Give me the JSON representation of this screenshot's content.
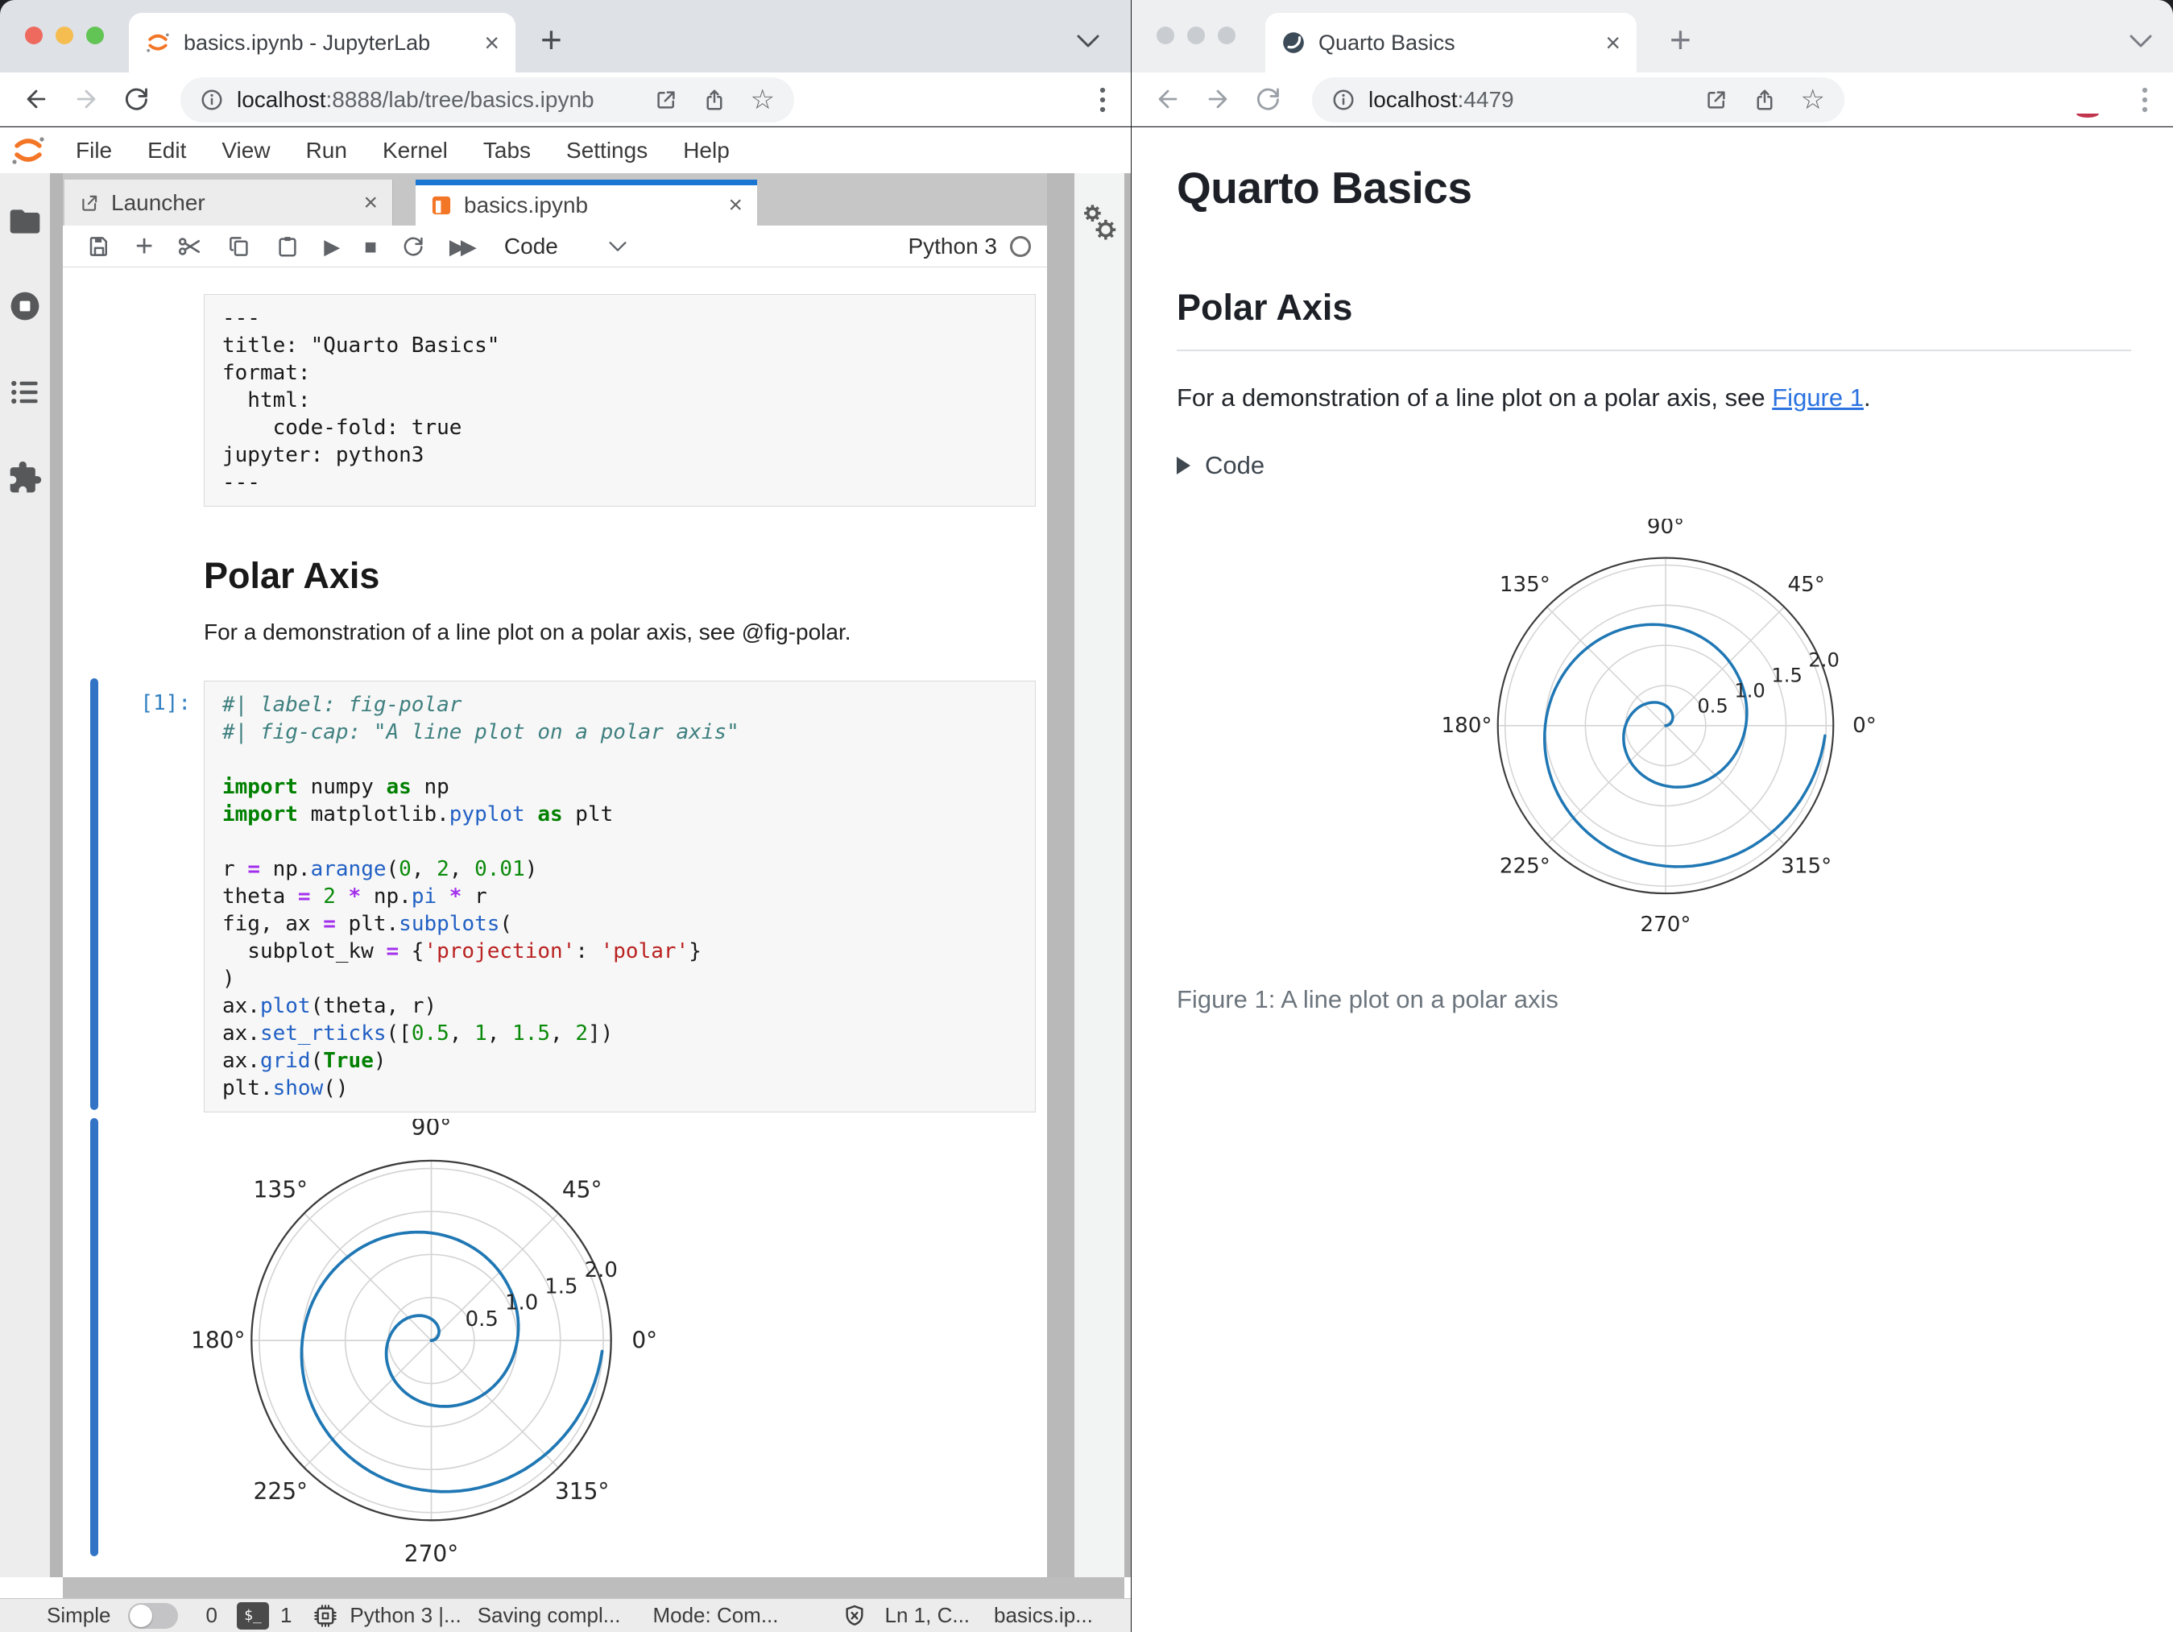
{
  "left_window": {
    "browser": {
      "tab_title": "basics.ipynb - JupyterLab",
      "close_glyph": "×",
      "new_tab_glyph": "+",
      "url_host": "localhost",
      "url_rest": ":8888/lab/tree/basics.ipynb"
    },
    "menu": [
      "File",
      "Edit",
      "View",
      "Run",
      "Kernel",
      "Tabs",
      "Settings",
      "Help"
    ],
    "doc_tabs": {
      "launcher": "Launcher",
      "notebook": "basics.ipynb",
      "close_glyph": "×"
    },
    "toolbar": {
      "plus_glyph": "+",
      "run_glyph": "▶",
      "stop_glyph": "■",
      "ff_glyph": "▶▶",
      "cell_type": "Code",
      "kernel_name": "Python 3"
    },
    "notebook": {
      "yaml_lines": [
        "---",
        "title: \"Quarto Basics\"",
        "format:",
        "  html:",
        "    code-fold: true",
        "jupyter: python3",
        "---"
      ],
      "md_heading": "Polar Axis",
      "md_paragraph": "For a demonstration of a line plot on a polar axis, see @fig-polar.",
      "execution_prompt": "[1]:",
      "code_lines": [
        [
          [
            "c",
            "#| label: fig-polar"
          ]
        ],
        [
          [
            "c",
            "#| fig-cap: \"A line plot on a polar axis\""
          ]
        ],
        [],
        [
          [
            "k",
            "import"
          ],
          [
            "t",
            " numpy "
          ],
          [
            "k",
            "as"
          ],
          [
            "t",
            " np"
          ]
        ],
        [
          [
            "k",
            "import"
          ],
          [
            "t",
            " matplotlib."
          ],
          [
            "p",
            "pyplot"
          ],
          [
            "t",
            " "
          ],
          [
            "k",
            "as"
          ],
          [
            "t",
            " plt"
          ]
        ],
        [],
        [
          [
            "t",
            "r "
          ],
          [
            "o",
            "="
          ],
          [
            "t",
            " np."
          ],
          [
            "p",
            "arange"
          ],
          [
            "t",
            "("
          ],
          [
            "n",
            "0"
          ],
          [
            "t",
            ", "
          ],
          [
            "n",
            "2"
          ],
          [
            "t",
            ", "
          ],
          [
            "n",
            "0.01"
          ],
          [
            "t",
            ")"
          ]
        ],
        [
          [
            "t",
            "theta "
          ],
          [
            "o",
            "="
          ],
          [
            "t",
            " "
          ],
          [
            "n",
            "2"
          ],
          [
            "t",
            " "
          ],
          [
            "o",
            "*"
          ],
          [
            "t",
            " np."
          ],
          [
            "p",
            "pi"
          ],
          [
            "t",
            " "
          ],
          [
            "o",
            "*"
          ],
          [
            "t",
            " r"
          ]
        ],
        [
          [
            "t",
            "fig, ax "
          ],
          [
            "o",
            "="
          ],
          [
            "t",
            " plt."
          ],
          [
            "p",
            "subplots"
          ],
          [
            "t",
            "("
          ]
        ],
        [
          [
            "t",
            "  subplot_kw "
          ],
          [
            "o",
            "="
          ],
          [
            "t",
            " {"
          ],
          [
            "s",
            "'projection'"
          ],
          [
            "t",
            ": "
          ],
          [
            "s",
            "'polar'"
          ],
          [
            "t",
            "}"
          ]
        ],
        [
          [
            "t",
            ")"
          ]
        ],
        [
          [
            "t",
            "ax."
          ],
          [
            "p",
            "plot"
          ],
          [
            "t",
            "(theta, r)"
          ]
        ],
        [
          [
            "t",
            "ax."
          ],
          [
            "p",
            "set_rticks"
          ],
          [
            "t",
            "(["
          ],
          [
            "n",
            "0.5"
          ],
          [
            "t",
            ", "
          ],
          [
            "n",
            "1"
          ],
          [
            "t",
            ", "
          ],
          [
            "n",
            "1.5"
          ],
          [
            "t",
            ", "
          ],
          [
            "n",
            "2"
          ],
          [
            "t",
            "])"
          ]
        ],
        [
          [
            "t",
            "ax."
          ],
          [
            "p",
            "grid"
          ],
          [
            "t",
            "("
          ],
          [
            "k",
            "True"
          ],
          [
            "t",
            ")"
          ]
        ],
        [
          [
            "t",
            "plt."
          ],
          [
            "p",
            "show"
          ],
          [
            "t",
            "()"
          ]
        ]
      ]
    },
    "status_bar": {
      "simple": "Simple",
      "terminals": "0",
      "terminal_glyph": "$_",
      "kernels": "1",
      "kernel": "Python 3 |...",
      "saving": "Saving compl...",
      "mode": "Mode: Com...",
      "cursor": "Ln 1, C...",
      "file": "basics.ip..."
    }
  },
  "right_window": {
    "browser": {
      "tab_title": "Quarto Basics",
      "close_glyph": "×",
      "new_tab_glyph": "+",
      "url_host": "localhost",
      "url_rest": ":4479"
    },
    "page": {
      "title": "Quarto Basics",
      "section": "Polar Axis",
      "para_before": "For a demonstration of a line plot on a polar axis, see ",
      "link": "Figure 1",
      "para_after": ".",
      "code_toggle": "Code",
      "figure_caption": "Figure 1: A line plot on a polar axis"
    }
  },
  "chart_data": {
    "type": "line",
    "projection": "polar",
    "title": "A line plot on a polar axis",
    "series": [
      {
        "name": "spiral",
        "r_start": 0,
        "r_end": 2,
        "r_step": 0.01,
        "theta_formula": "theta = 2*pi*r"
      }
    ],
    "theta_ticks_deg": [
      0,
      45,
      90,
      135,
      180,
      225,
      270,
      315
    ],
    "theta_tick_labels": [
      "0°",
      "45°",
      "90°",
      "135°",
      "180°",
      "225°",
      "270°",
      "315°"
    ],
    "r_ticks": [
      0.5,
      1,
      1.5,
      2
    ],
    "r_tick_labels": [
      "0.5",
      "1.0",
      "1.5",
      "2.0"
    ],
    "r_axis_max": 2.09,
    "r_label_angle_deg": 22.5,
    "grid": true,
    "line_color": "#1f77b4"
  }
}
